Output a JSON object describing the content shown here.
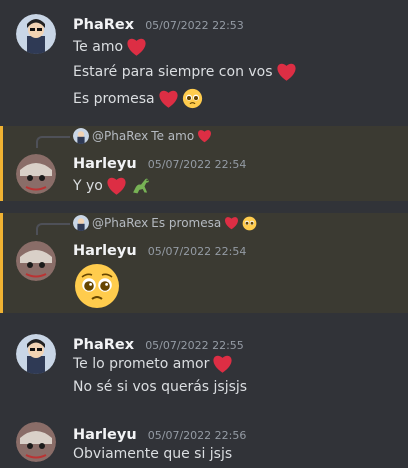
{
  "messages": [
    {
      "author": "PhaRex",
      "timestamp": "05/07/2022 22:53",
      "lines": [
        "Te amo",
        "Estaré para siempre con vos",
        "Es promesa"
      ]
    },
    {
      "author": "Harleyu",
      "timestamp": "05/07/2022 22:54",
      "reply_mention": "@PhaRex",
      "reply_text": "Te amo",
      "lines": [
        "Y yo"
      ]
    },
    {
      "author": "Harleyu",
      "timestamp": "05/07/2022 22:54",
      "reply_mention": "@PhaRex",
      "reply_text": "Es promesa"
    },
    {
      "author": "PhaRex",
      "timestamp": "05/07/2022 22:55",
      "lines": [
        "Te lo prometo amor",
        "No sé si vos querás jsjsjs"
      ]
    },
    {
      "author": "Harleyu",
      "timestamp": "05/07/2022 22:56",
      "lines": [
        "Obviamente que si jsjs"
      ]
    }
  ],
  "colors": {
    "background": "#313338",
    "highlight": "#3b3a32",
    "highlight_bar": "#f0b232",
    "heart": "#dd2e44"
  }
}
